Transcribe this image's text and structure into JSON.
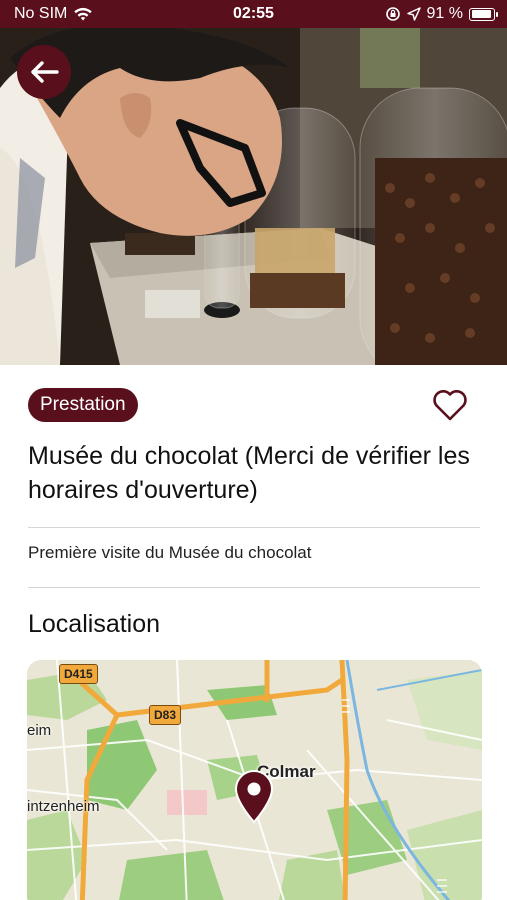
{
  "status_bar": {
    "carrier": "No SIM",
    "time": "02:55",
    "battery": "91 %",
    "battery_level": 0.91
  },
  "header": {
    "back_icon": "arrow-left-icon"
  },
  "detail": {
    "badge": "Prestation",
    "favorite_icon": "heart-icon",
    "title": "Musée du chocolat (Merci de vérifier les horaires d'ouverture)",
    "description": "Première visite du Musée du chocolat",
    "location_heading": "Localisation"
  },
  "map": {
    "places": [
      "Colmar",
      "eim",
      "intzenheim"
    ],
    "roads": [
      "D415",
      "D83"
    ],
    "marker_icon": "map-pin-icon"
  },
  "colors": {
    "accent": "#5a0f1c"
  }
}
